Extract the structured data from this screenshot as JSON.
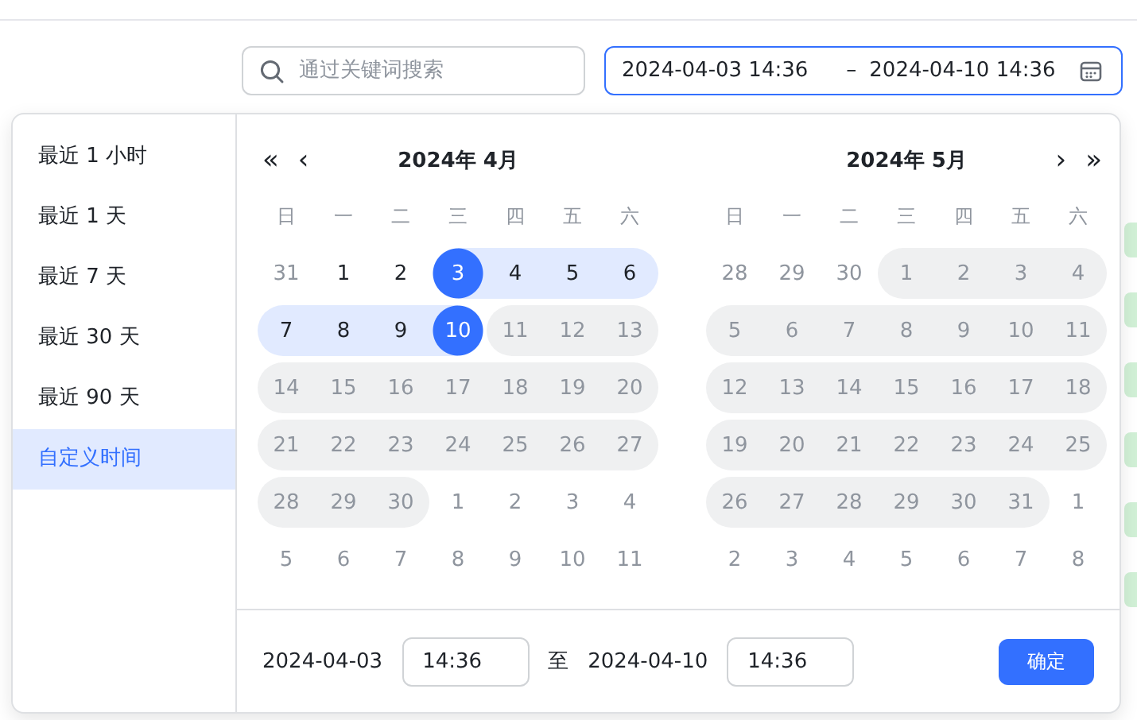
{
  "search": {
    "placeholder": "通过关键词搜索"
  },
  "range_input": {
    "start": "2024-04-03 14:36",
    "separator": "–",
    "end": "2024-04-10 14:36",
    "focused": true
  },
  "shortcuts": [
    {
      "label": "最近 1 小时",
      "selected": false
    },
    {
      "label": "最近 1 天",
      "selected": false
    },
    {
      "label": "最近 7 天",
      "selected": false
    },
    {
      "label": "最近 30 天",
      "selected": false
    },
    {
      "label": "最近 90 天",
      "selected": false
    },
    {
      "label": "自定义时间",
      "selected": true
    }
  ],
  "calendars": [
    {
      "title": "2024年 4月",
      "nav": [
        "«",
        "‹"
      ],
      "weekdays": [
        "日",
        "一",
        "二",
        "三",
        "四",
        "五",
        "六"
      ],
      "weeks": [
        [
          {
            "day": "31",
            "kind": "other"
          },
          {
            "day": "1",
            "kind": "normal"
          },
          {
            "day": "2",
            "kind": "normal"
          },
          {
            "day": "3",
            "kind": "start"
          },
          {
            "day": "4",
            "kind": "range"
          },
          {
            "day": "5",
            "kind": "range"
          },
          {
            "day": "6",
            "kind": "range"
          }
        ],
        [
          {
            "day": "7",
            "kind": "range"
          },
          {
            "day": "8",
            "kind": "range"
          },
          {
            "day": "9",
            "kind": "range"
          },
          {
            "day": "10",
            "kind": "end"
          },
          {
            "day": "11",
            "kind": "disabled"
          },
          {
            "day": "12",
            "kind": "disabled"
          },
          {
            "day": "13",
            "kind": "disabled"
          }
        ],
        [
          {
            "day": "14",
            "kind": "disabled"
          },
          {
            "day": "15",
            "kind": "disabled"
          },
          {
            "day": "16",
            "kind": "disabled"
          },
          {
            "day": "17",
            "kind": "disabled"
          },
          {
            "day": "18",
            "kind": "disabled"
          },
          {
            "day": "19",
            "kind": "disabled"
          },
          {
            "day": "20",
            "kind": "disabled"
          }
        ],
        [
          {
            "day": "21",
            "kind": "disabled"
          },
          {
            "day": "22",
            "kind": "disabled"
          },
          {
            "day": "23",
            "kind": "disabled"
          },
          {
            "day": "24",
            "kind": "disabled"
          },
          {
            "day": "25",
            "kind": "disabled"
          },
          {
            "day": "26",
            "kind": "disabled"
          },
          {
            "day": "27",
            "kind": "disabled"
          }
        ],
        [
          {
            "day": "28",
            "kind": "disabled"
          },
          {
            "day": "29",
            "kind": "disabled"
          },
          {
            "day": "30",
            "kind": "disabled"
          },
          {
            "day": "1",
            "kind": "other"
          },
          {
            "day": "2",
            "kind": "other"
          },
          {
            "day": "3",
            "kind": "other"
          },
          {
            "day": "4",
            "kind": "other"
          }
        ],
        [
          {
            "day": "5",
            "kind": "other"
          },
          {
            "day": "6",
            "kind": "other"
          },
          {
            "day": "7",
            "kind": "other"
          },
          {
            "day": "8",
            "kind": "other"
          },
          {
            "day": "9",
            "kind": "other"
          },
          {
            "day": "10",
            "kind": "other"
          },
          {
            "day": "11",
            "kind": "other"
          }
        ]
      ]
    },
    {
      "title": "2024年 5月",
      "nav": [
        "›",
        "»"
      ],
      "weekdays": [
        "日",
        "一",
        "二",
        "三",
        "四",
        "五",
        "六"
      ],
      "weeks": [
        [
          {
            "day": "28",
            "kind": "other"
          },
          {
            "day": "29",
            "kind": "other"
          },
          {
            "day": "30",
            "kind": "other"
          },
          {
            "day": "1",
            "kind": "disabled"
          },
          {
            "day": "2",
            "kind": "disabled"
          },
          {
            "day": "3",
            "kind": "disabled"
          },
          {
            "day": "4",
            "kind": "disabled"
          }
        ],
        [
          {
            "day": "5",
            "kind": "disabled"
          },
          {
            "day": "6",
            "kind": "disabled"
          },
          {
            "day": "7",
            "kind": "disabled"
          },
          {
            "day": "8",
            "kind": "disabled"
          },
          {
            "day": "9",
            "kind": "disabled"
          },
          {
            "day": "10",
            "kind": "disabled"
          },
          {
            "day": "11",
            "kind": "disabled"
          }
        ],
        [
          {
            "day": "12",
            "kind": "disabled"
          },
          {
            "day": "13",
            "kind": "disabled"
          },
          {
            "day": "14",
            "kind": "disabled"
          },
          {
            "day": "15",
            "kind": "disabled"
          },
          {
            "day": "16",
            "kind": "disabled"
          },
          {
            "day": "17",
            "kind": "disabled"
          },
          {
            "day": "18",
            "kind": "disabled"
          }
        ],
        [
          {
            "day": "19",
            "kind": "disabled"
          },
          {
            "day": "20",
            "kind": "disabled"
          },
          {
            "day": "21",
            "kind": "disabled"
          },
          {
            "day": "22",
            "kind": "disabled"
          },
          {
            "day": "23",
            "kind": "disabled"
          },
          {
            "day": "24",
            "kind": "disabled"
          },
          {
            "day": "25",
            "kind": "disabled"
          }
        ],
        [
          {
            "day": "26",
            "kind": "disabled"
          },
          {
            "day": "27",
            "kind": "disabled"
          },
          {
            "day": "28",
            "kind": "disabled"
          },
          {
            "day": "29",
            "kind": "disabled"
          },
          {
            "day": "30",
            "kind": "disabled"
          },
          {
            "day": "31",
            "kind": "disabled"
          },
          {
            "day": "1",
            "kind": "other"
          }
        ],
        [
          {
            "day": "2",
            "kind": "other"
          },
          {
            "day": "3",
            "kind": "other"
          },
          {
            "day": "4",
            "kind": "other"
          },
          {
            "day": "5",
            "kind": "other"
          },
          {
            "day": "6",
            "kind": "other"
          },
          {
            "day": "7",
            "kind": "other"
          },
          {
            "day": "8",
            "kind": "other"
          }
        ]
      ]
    }
  ],
  "footer": {
    "start_date": "2024-04-03",
    "start_time": "14:36",
    "to": "至",
    "end_date": "2024-04-10",
    "end_time": "14:36",
    "confirm": "确定"
  }
}
